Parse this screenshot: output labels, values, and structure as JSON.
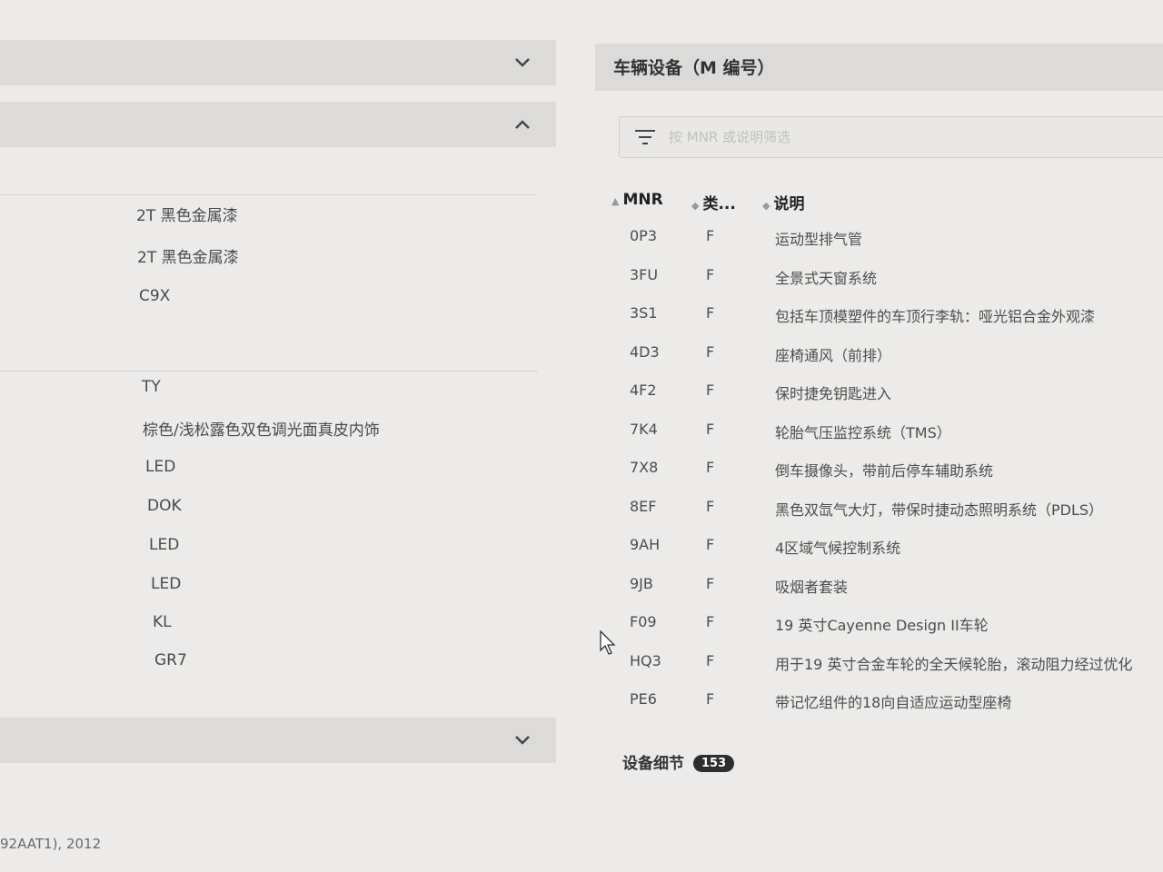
{
  "left_panel": {
    "values": [
      "2T 黑色金属漆",
      "2T 黑色金属漆",
      "C9X",
      "TY",
      "棕色/浅松露色双色调光面真皮内饰",
      "LED",
      "DOK",
      "LED",
      "LED",
      "KL",
      "GR7"
    ],
    "footer": "92AAT1), 2012"
  },
  "right_panel": {
    "title": "车辆设备（M 编号）",
    "filter_placeholder": "按 MNR 或说明筛选",
    "columns": {
      "mnr": "MNR",
      "type": "类...",
      "desc": "说明"
    },
    "rows": [
      {
        "mnr": "0P3",
        "type": "F",
        "desc": "运动型排气管"
      },
      {
        "mnr": "3FU",
        "type": "F",
        "desc": "全景式天窗系统"
      },
      {
        "mnr": "3S1",
        "type": "F",
        "desc": "包括车顶模塑件的车顶行李轨：哑光铝合金外观漆"
      },
      {
        "mnr": "4D3",
        "type": "F",
        "desc": "座椅通风（前排）"
      },
      {
        "mnr": "4F2",
        "type": "F",
        "desc": "保时捷免钥匙进入"
      },
      {
        "mnr": "7K4",
        "type": "F",
        "desc": "轮胎气压监控系统（TMS）"
      },
      {
        "mnr": "7X8",
        "type": "F",
        "desc": "倒车摄像头，带前后停车辅助系统"
      },
      {
        "mnr": "8EF",
        "type": "F",
        "desc": "黑色双氙气大灯，带保时捷动态照明系统（PDLS）"
      },
      {
        "mnr": "9AH",
        "type": "F",
        "desc": "4区域气候控制系统"
      },
      {
        "mnr": "9JB",
        "type": "F",
        "desc": "吸烟者套装"
      },
      {
        "mnr": "F09",
        "type": "F",
        "desc": "19 英寸Cayenne Design II车轮"
      },
      {
        "mnr": "HQ3",
        "type": "F",
        "desc": "用于19 英寸合金车轮的全天候轮胎，滚动阻力经过优化"
      },
      {
        "mnr": "PE6",
        "type": "F",
        "desc": "带记忆组件的18向自适应运动型座椅"
      }
    ],
    "equipment_details_label": "设备细节",
    "equipment_count": "153"
  },
  "icons": {
    "chevron_down": "chevron-down-icon",
    "chevron_up": "chevron-up-icon",
    "filter": "filter-icon",
    "sort": "sort-icon"
  },
  "colors": {
    "background": "#ecebe9",
    "section_bar": "#dcdbd9",
    "badge": "#2d2d2d"
  }
}
